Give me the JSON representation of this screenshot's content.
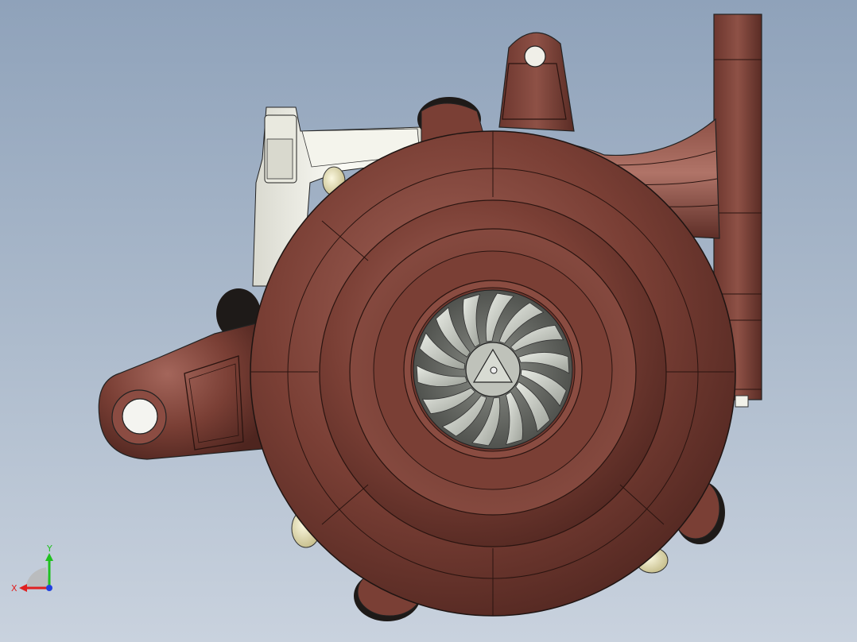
{
  "viewport": {
    "model_name": "turbocharger-3d-model",
    "view": "front"
  },
  "triad": {
    "x_label": "X",
    "y_label": "Y",
    "colors": {
      "x": "#e02020",
      "y": "#20c020",
      "z": "#2040e0"
    }
  },
  "colors": {
    "housing": "#7a3f35",
    "housing_light": "#a4665b",
    "housing_dark": "#4a221c",
    "compressor_wheel": "#c9ccc4",
    "actuator": "#f2f2ea",
    "bolt_yellow": "#f1eabd"
  }
}
